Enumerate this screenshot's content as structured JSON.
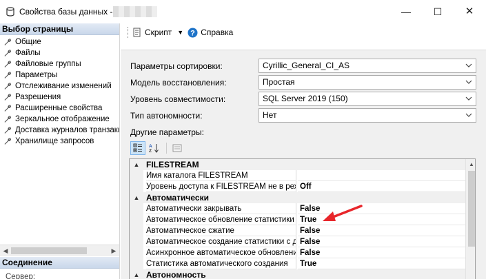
{
  "window": {
    "title": "Свойства базы данных -",
    "controls": {
      "minimize": "—",
      "maximize": "☐",
      "close": "✕"
    }
  },
  "left_pane": {
    "header": "Выбор страницы",
    "items": [
      "Общие",
      "Файлы",
      "Файловые группы",
      "Параметры",
      "Отслеживание изменений",
      "Разрешения",
      "Расширенные свойства",
      "Зеркальное отображение",
      "Доставка журналов транзакций",
      "Хранилище запросов"
    ],
    "connection_header": "Соединение",
    "server_label": "Сервер:"
  },
  "toolbar": {
    "script_label": "Скрипт",
    "help_label": "Справка"
  },
  "form": {
    "collation": {
      "label": "Параметры сортировки:",
      "value": "Cyrillic_General_CI_AS"
    },
    "recovery_model": {
      "label": "Модель восстановления:",
      "value": "Простая"
    },
    "compatibility": {
      "label": "Уровень совместимости:",
      "value": "SQL Server 2019 (150)"
    },
    "containment": {
      "label": "Тип автономности:",
      "value": "Нет"
    },
    "other_options_label": "Другие параметры:"
  },
  "property_grid": {
    "rows": [
      {
        "kind": "category",
        "name": "FILESTREAM"
      },
      {
        "kind": "prop",
        "name": "Имя каталога FILESTREAM",
        "value": ""
      },
      {
        "kind": "prop",
        "name": "Уровень доступа к FILESTREAM не в режиме",
        "value": "Off"
      },
      {
        "kind": "category",
        "name": "Автоматически"
      },
      {
        "kind": "prop",
        "name": "Автоматически закрывать",
        "value": "False"
      },
      {
        "kind": "prop",
        "name": "Автоматическое обновление статистики",
        "value": "True"
      },
      {
        "kind": "prop",
        "name": "Автоматическое сжатие",
        "value": "False"
      },
      {
        "kind": "prop",
        "name": "Автоматическое создание статистики с добавочной",
        "value": "False"
      },
      {
        "kind": "prop",
        "name": "Асинхронное автоматическое обновление статистики",
        "value": "False"
      },
      {
        "kind": "prop",
        "name": "Статистика автоматического создания",
        "value": "True"
      },
      {
        "kind": "category",
        "name": "Автономность"
      }
    ]
  },
  "colors": {
    "annotation_arrow": "#e8262b",
    "section_header": "#c9d7ea",
    "help_icon": "#1e73c8"
  }
}
